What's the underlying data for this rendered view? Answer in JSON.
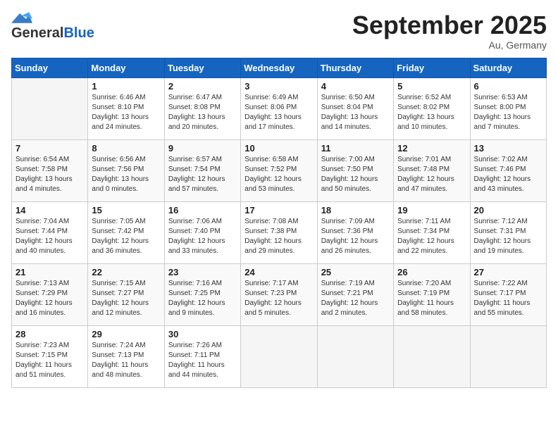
{
  "header": {
    "logo_general": "General",
    "logo_blue": "Blue",
    "month_title": "September 2025",
    "subtitle": "Au, Germany"
  },
  "weekdays": [
    "Sunday",
    "Monday",
    "Tuesday",
    "Wednesday",
    "Thursday",
    "Friday",
    "Saturday"
  ],
  "weeks": [
    [
      {
        "day": "",
        "info": ""
      },
      {
        "day": "1",
        "info": "Sunrise: 6:46 AM\nSunset: 8:10 PM\nDaylight: 13 hours\nand 24 minutes."
      },
      {
        "day": "2",
        "info": "Sunrise: 6:47 AM\nSunset: 8:08 PM\nDaylight: 13 hours\nand 20 minutes."
      },
      {
        "day": "3",
        "info": "Sunrise: 6:49 AM\nSunset: 8:06 PM\nDaylight: 13 hours\nand 17 minutes."
      },
      {
        "day": "4",
        "info": "Sunrise: 6:50 AM\nSunset: 8:04 PM\nDaylight: 13 hours\nand 14 minutes."
      },
      {
        "day": "5",
        "info": "Sunrise: 6:52 AM\nSunset: 8:02 PM\nDaylight: 13 hours\nand 10 minutes."
      },
      {
        "day": "6",
        "info": "Sunrise: 6:53 AM\nSunset: 8:00 PM\nDaylight: 13 hours\nand 7 minutes."
      }
    ],
    [
      {
        "day": "7",
        "info": "Sunrise: 6:54 AM\nSunset: 7:58 PM\nDaylight: 13 hours\nand 4 minutes."
      },
      {
        "day": "8",
        "info": "Sunrise: 6:56 AM\nSunset: 7:56 PM\nDaylight: 13 hours\nand 0 minutes."
      },
      {
        "day": "9",
        "info": "Sunrise: 6:57 AM\nSunset: 7:54 PM\nDaylight: 12 hours\nand 57 minutes."
      },
      {
        "day": "10",
        "info": "Sunrise: 6:58 AM\nSunset: 7:52 PM\nDaylight: 12 hours\nand 53 minutes."
      },
      {
        "day": "11",
        "info": "Sunrise: 7:00 AM\nSunset: 7:50 PM\nDaylight: 12 hours\nand 50 minutes."
      },
      {
        "day": "12",
        "info": "Sunrise: 7:01 AM\nSunset: 7:48 PM\nDaylight: 12 hours\nand 47 minutes."
      },
      {
        "day": "13",
        "info": "Sunrise: 7:02 AM\nSunset: 7:46 PM\nDaylight: 12 hours\nand 43 minutes."
      }
    ],
    [
      {
        "day": "14",
        "info": "Sunrise: 7:04 AM\nSunset: 7:44 PM\nDaylight: 12 hours\nand 40 minutes."
      },
      {
        "day": "15",
        "info": "Sunrise: 7:05 AM\nSunset: 7:42 PM\nDaylight: 12 hours\nand 36 minutes."
      },
      {
        "day": "16",
        "info": "Sunrise: 7:06 AM\nSunset: 7:40 PM\nDaylight: 12 hours\nand 33 minutes."
      },
      {
        "day": "17",
        "info": "Sunrise: 7:08 AM\nSunset: 7:38 PM\nDaylight: 12 hours\nand 29 minutes."
      },
      {
        "day": "18",
        "info": "Sunrise: 7:09 AM\nSunset: 7:36 PM\nDaylight: 12 hours\nand 26 minutes."
      },
      {
        "day": "19",
        "info": "Sunrise: 7:11 AM\nSunset: 7:34 PM\nDaylight: 12 hours\nand 22 minutes."
      },
      {
        "day": "20",
        "info": "Sunrise: 7:12 AM\nSunset: 7:31 PM\nDaylight: 12 hours\nand 19 minutes."
      }
    ],
    [
      {
        "day": "21",
        "info": "Sunrise: 7:13 AM\nSunset: 7:29 PM\nDaylight: 12 hours\nand 16 minutes."
      },
      {
        "day": "22",
        "info": "Sunrise: 7:15 AM\nSunset: 7:27 PM\nDaylight: 12 hours\nand 12 minutes."
      },
      {
        "day": "23",
        "info": "Sunrise: 7:16 AM\nSunset: 7:25 PM\nDaylight: 12 hours\nand 9 minutes."
      },
      {
        "day": "24",
        "info": "Sunrise: 7:17 AM\nSunset: 7:23 PM\nDaylight: 12 hours\nand 5 minutes."
      },
      {
        "day": "25",
        "info": "Sunrise: 7:19 AM\nSunset: 7:21 PM\nDaylight: 12 hours\nand 2 minutes."
      },
      {
        "day": "26",
        "info": "Sunrise: 7:20 AM\nSunset: 7:19 PM\nDaylight: 11 hours\nand 58 minutes."
      },
      {
        "day": "27",
        "info": "Sunrise: 7:22 AM\nSunset: 7:17 PM\nDaylight: 11 hours\nand 55 minutes."
      }
    ],
    [
      {
        "day": "28",
        "info": "Sunrise: 7:23 AM\nSunset: 7:15 PM\nDaylight: 11 hours\nand 51 minutes."
      },
      {
        "day": "29",
        "info": "Sunrise: 7:24 AM\nSunset: 7:13 PM\nDaylight: 11 hours\nand 48 minutes."
      },
      {
        "day": "30",
        "info": "Sunrise: 7:26 AM\nSunset: 7:11 PM\nDaylight: 11 hours\nand 44 minutes."
      },
      {
        "day": "",
        "info": ""
      },
      {
        "day": "",
        "info": ""
      },
      {
        "day": "",
        "info": ""
      },
      {
        "day": "",
        "info": ""
      }
    ]
  ]
}
